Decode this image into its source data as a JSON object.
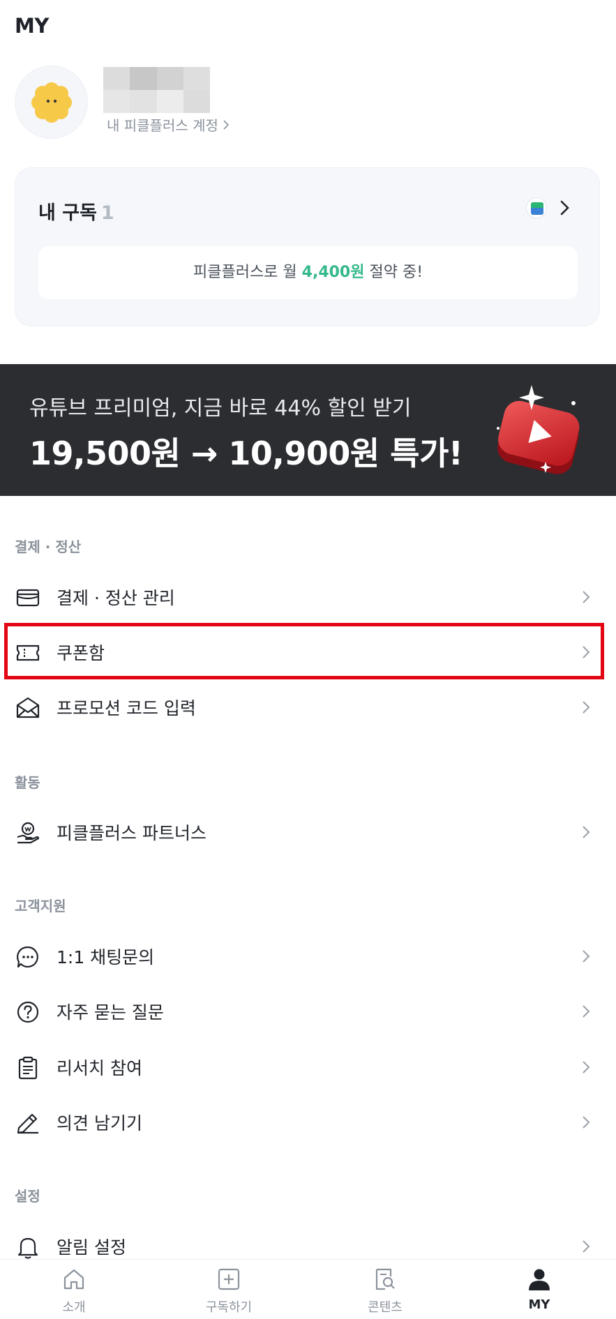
{
  "header": {
    "title": "MY"
  },
  "profile": {
    "account_link": "내 피클플러스 계정"
  },
  "subscription": {
    "title": "내 구독",
    "count": "1",
    "savings_prefix": "피클플러스로 월 ",
    "savings_amount": "4,400원",
    "savings_suffix": " 절약 중!"
  },
  "banner": {
    "subtitle": "유튜브 프리미엄, 지금 바로 44% 할인 받기",
    "headline": "19,500원 → 10,900원 특가!"
  },
  "sections": {
    "payment": {
      "label": "결제 · 정산",
      "items": [
        {
          "label": "결제 · 정산 관리",
          "icon": "wallet-icon"
        },
        {
          "label": "쿠폰함",
          "icon": "ticket-icon"
        },
        {
          "label": "프로모션 코드 입력",
          "icon": "envelope-icon"
        }
      ]
    },
    "activity": {
      "label": "활동",
      "items": [
        {
          "label": "피클플러스 파트너스",
          "icon": "hand-coin-icon"
        }
      ]
    },
    "support": {
      "label": "고객지원",
      "items": [
        {
          "label": "1:1 채팅문의",
          "icon": "chat-bubble-icon"
        },
        {
          "label": "자주 묻는 질문",
          "icon": "question-circle-icon"
        },
        {
          "label": "리서치 참여",
          "icon": "clipboard-icon"
        },
        {
          "label": "의견 남기기",
          "icon": "pencil-icon"
        }
      ]
    },
    "settings": {
      "label": "설정",
      "items": [
        {
          "label": "알림 설정",
          "icon": "bell-icon"
        }
      ]
    }
  },
  "bottom_nav": [
    {
      "label": "소개",
      "icon": "home-icon",
      "active": false
    },
    {
      "label": "구독하기",
      "icon": "plus-square-icon",
      "active": false
    },
    {
      "label": "콘텐츠",
      "icon": "document-search-icon",
      "active": false
    },
    {
      "label": "MY",
      "icon": "user-icon",
      "active": true
    }
  ],
  "colors": {
    "accent_green": "#35b98a",
    "banner_bg": "#2b2d31",
    "highlight_red": "#e30613",
    "muted_text": "#8b929c"
  }
}
